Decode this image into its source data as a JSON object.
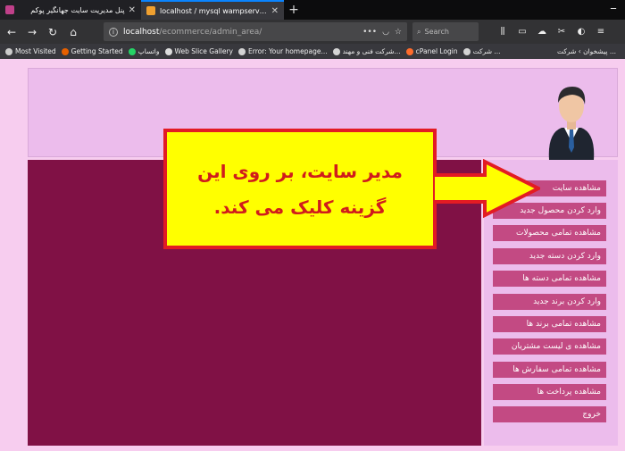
{
  "browser": {
    "tabs": [
      {
        "title": "پنل مدیریت سایت جهانگیر پوکم",
        "active": false,
        "favicon_color": "#c0408a"
      },
      {
        "title": "localhost / mysql wampserver | php",
        "active": true,
        "favicon_color": "#f0a030"
      }
    ],
    "url_host": "localhost",
    "url_path": "/ecommerce/admin_area/",
    "search_placeholder": "Search",
    "bookmarks": [
      {
        "label": "Most Visited",
        "icon_color": "#cccccc"
      },
      {
        "label": "Getting Started",
        "icon_color": "#e66000"
      },
      {
        "label": "واتساپ",
        "icon_color": "#25d366"
      },
      {
        "label": "Web Slice Gallery",
        "icon_color": "#dddddd"
      },
      {
        "label": "Error: Your homepage...",
        "icon_color": "#d4d4d4"
      },
      {
        "label": "شرکت فنی و مهند...",
        "icon_color": "#d4d4d4"
      },
      {
        "label": "cPanel Login",
        "icon_color": "#ff6c2c"
      },
      {
        "label": "شرکت ...",
        "icon_color": "#d4d4d4"
      }
    ],
    "bookmarks_right": "پیشخوان › شرکت ..."
  },
  "sidebar_menu": [
    "مشاهده سایت",
    "وارد کردن محصول جدید",
    "مشاهده تمامی محصولات",
    "وارد کردن دسته جدید",
    "مشاهده تمامی دسته ها",
    "وارد کردن برند جدید",
    "مشاهده تمامی برند ها",
    "مشاهده ی لیست مشتریان",
    "مشاهده تمامی سفارش ها",
    "مشاهده پرداخت ها",
    "خروج"
  ],
  "callout": {
    "line1": "مدیر سایت، بر روی این",
    "line2": "گزینه کلیک می کند."
  },
  "colors": {
    "page_bg": "#f7cdef",
    "header_bg": "#ecbcec",
    "content_bg": "#801145",
    "menu_button": "#c34a83",
    "callout_bg": "#ffff00",
    "callout_border": "#e31b23"
  }
}
